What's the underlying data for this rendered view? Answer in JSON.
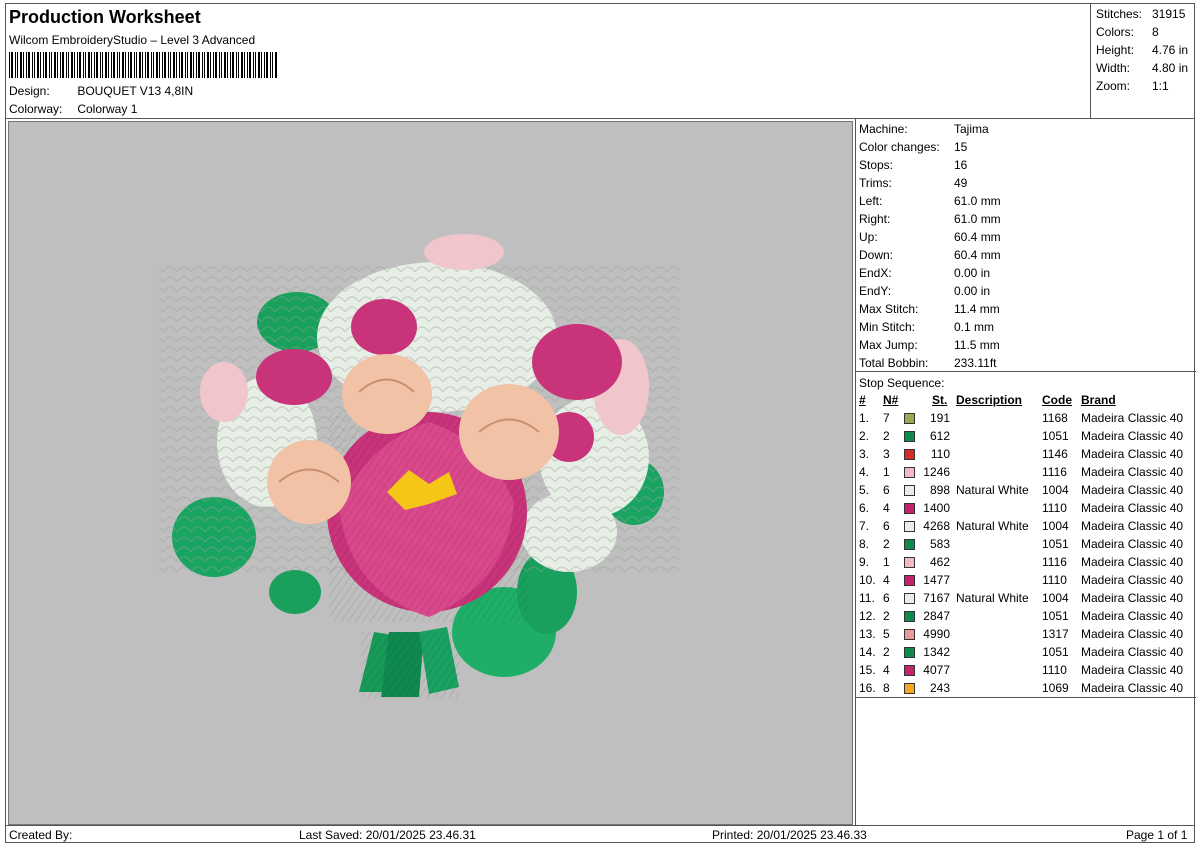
{
  "header": {
    "title": "Production Worksheet",
    "subtitle": "Wilcom EmbroideryStudio – Level 3 Advanced",
    "design_label": "Design:",
    "design_value": "BOUQUET V13 4,8IN",
    "colorway_label": "Colorway:",
    "colorway_value": "Colorway 1"
  },
  "stats": [
    {
      "label": "Stitches:",
      "value": "31915"
    },
    {
      "label": "Colors:",
      "value": "8"
    },
    {
      "label": "Height:",
      "value": "4.76 in"
    },
    {
      "label": "Width:",
      "value": "4.80 in"
    },
    {
      "label": "Zoom:",
      "value": "1:1"
    }
  ],
  "machine": [
    {
      "label": "Machine:",
      "value": "Tajima"
    },
    {
      "label": "Color changes:",
      "value": "15"
    },
    {
      "label": "Stops:",
      "value": "16"
    },
    {
      "label": "Trims:",
      "value": "49"
    },
    {
      "label": "Left:",
      "value": "61.0 mm"
    },
    {
      "label": "Right:",
      "value": "61.0 mm"
    },
    {
      "label": "Up:",
      "value": "60.4 mm"
    },
    {
      "label": "Down:",
      "value": "60.4 mm"
    },
    {
      "label": "EndX:",
      "value": "0.00 in"
    },
    {
      "label": "EndY:",
      "value": "0.00 in"
    },
    {
      "label": "Max Stitch:",
      "value": "11.4 mm"
    },
    {
      "label": "Min Stitch:",
      "value": "0.1 mm"
    },
    {
      "label": "Max Jump:",
      "value": "11.5 mm"
    },
    {
      "label": "Total Bobbin:",
      "value": "233.11ft"
    }
  ],
  "sequence": {
    "title": "Stop Sequence:",
    "columns": {
      "index": "#",
      "needle": "N#",
      "stitches": "St.",
      "description": "Description",
      "code": "Code",
      "brand": "Brand"
    },
    "rows": [
      {
        "index": "1.",
        "needle": "7",
        "color": "#9ea850",
        "stitches": "191",
        "description": "",
        "code": "1168",
        "brand": "Madeira Classic 40"
      },
      {
        "index": "2.",
        "needle": "2",
        "color": "#0f8a4e",
        "stitches": "612",
        "description": "",
        "code": "1051",
        "brand": "Madeira Classic 40"
      },
      {
        "index": "3.",
        "needle": "3",
        "color": "#d42b2b",
        "stitches": "110",
        "description": "",
        "code": "1146",
        "brand": "Madeira Classic 40"
      },
      {
        "index": "4.",
        "needle": "1",
        "color": "#f2b8c4",
        "stitches": "1246",
        "description": "",
        "code": "1116",
        "brand": "Madeira Classic 40"
      },
      {
        "index": "5.",
        "needle": "6",
        "color": "#ececec",
        "stitches": "898",
        "description": "Natural White",
        "code": "1004",
        "brand": "Madeira Classic 40"
      },
      {
        "index": "6.",
        "needle": "4",
        "color": "#c3246b",
        "stitches": "1400",
        "description": "",
        "code": "1110",
        "brand": "Madeira Classic 40"
      },
      {
        "index": "7.",
        "needle": "6",
        "color": "#ececec",
        "stitches": "4268",
        "description": "Natural White",
        "code": "1004",
        "brand": "Madeira Classic 40"
      },
      {
        "index": "8.",
        "needle": "2",
        "color": "#0f8a4e",
        "stitches": "583",
        "description": "",
        "code": "1051",
        "brand": "Madeira Classic 40"
      },
      {
        "index": "9.",
        "needle": "1",
        "color": "#f2b8c4",
        "stitches": "462",
        "description": "",
        "code": "1116",
        "brand": "Madeira Classic 40"
      },
      {
        "index": "10.",
        "needle": "4",
        "color": "#c3246b",
        "stitches": "1477",
        "description": "",
        "code": "1110",
        "brand": "Madeira Classic 40"
      },
      {
        "index": "11.",
        "needle": "6",
        "color": "#ececec",
        "stitches": "7167",
        "description": "Natural White",
        "code": "1004",
        "brand": "Madeira Classic 40"
      },
      {
        "index": "12.",
        "needle": "2",
        "color": "#0f8a4e",
        "stitches": "2847",
        "description": "",
        "code": "1051",
        "brand": "Madeira Classic 40"
      },
      {
        "index": "13.",
        "needle": "5",
        "color": "#e89a9a",
        "stitches": "4990",
        "description": "",
        "code": "1317",
        "brand": "Madeira Classic 40"
      },
      {
        "index": "14.",
        "needle": "2",
        "color": "#0f8a4e",
        "stitches": "1342",
        "description": "",
        "code": "1051",
        "brand": "Madeira Classic 40"
      },
      {
        "index": "15.",
        "needle": "4",
        "color": "#c3246b",
        "stitches": "4077",
        "description": "",
        "code": "1110",
        "brand": "Madeira Classic 40"
      },
      {
        "index": "16.",
        "needle": "8",
        "color": "#f5a623",
        "stitches": "243",
        "description": "",
        "code": "1069",
        "brand": "Madeira Classic 40"
      }
    ]
  },
  "footer": {
    "created_by": "Created By:",
    "last_saved": "Last Saved: 20/01/2025 23.46.31",
    "printed": "Printed: 20/01/2025 23.46.33",
    "page": "Page 1 of 1"
  },
  "preview": {
    "icon": "embroidery-bouquet-image",
    "background": "#bfbfbf"
  }
}
